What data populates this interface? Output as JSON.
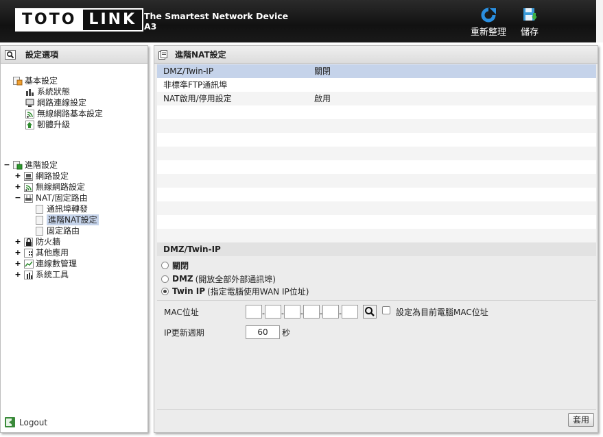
{
  "header": {
    "logo_left": "TOTO",
    "logo_right": "LINK",
    "title_line1": "The Smartest Network Device",
    "title_line2": "A3",
    "refresh_label": "重新整理",
    "save_label": "儲存"
  },
  "sidebar": {
    "title": "設定選項",
    "basic": {
      "label": "基本設定",
      "items": [
        "系統狀態",
        "網路連線設定",
        "無線網路基本設定",
        "韌體升級"
      ]
    },
    "advanced": {
      "label": "進階設定",
      "items": [
        "網路設定",
        "無線網路設定",
        "NAT/固定路由"
      ],
      "nat_children": [
        "通訊埠轉發",
        "進階NAT設定",
        "固定路由"
      ],
      "after": [
        "防火牆",
        "其他應用",
        "連線數管理",
        "系統工具"
      ]
    },
    "logout": "Logout"
  },
  "main": {
    "title": "進階NAT設定",
    "rows": [
      {
        "name": "DMZ/Twin-IP",
        "value": "關閉"
      },
      {
        "name": "非標準FTP通訊埠",
        "value": ""
      },
      {
        "name": "NAT啟用/停用設定",
        "value": "啟用"
      }
    ],
    "section_title": "DMZ/Twin-IP",
    "options": [
      {
        "bold": "關閉",
        "rest": ""
      },
      {
        "bold": "DMZ",
        "rest": "(開放全部外部通訊埠)"
      },
      {
        "bold": "Twin IP",
        "rest": "(指定電腦使用WAN IP位址)"
      }
    ],
    "selected_option": 2,
    "mac_label": "MAC位址",
    "mac_checkbox_label": "設定為目前電腦MAC位址",
    "ip_update_label": "IP更新週期",
    "ip_update_value": "60",
    "ip_update_unit": "秒",
    "apply_label": "套用"
  }
}
